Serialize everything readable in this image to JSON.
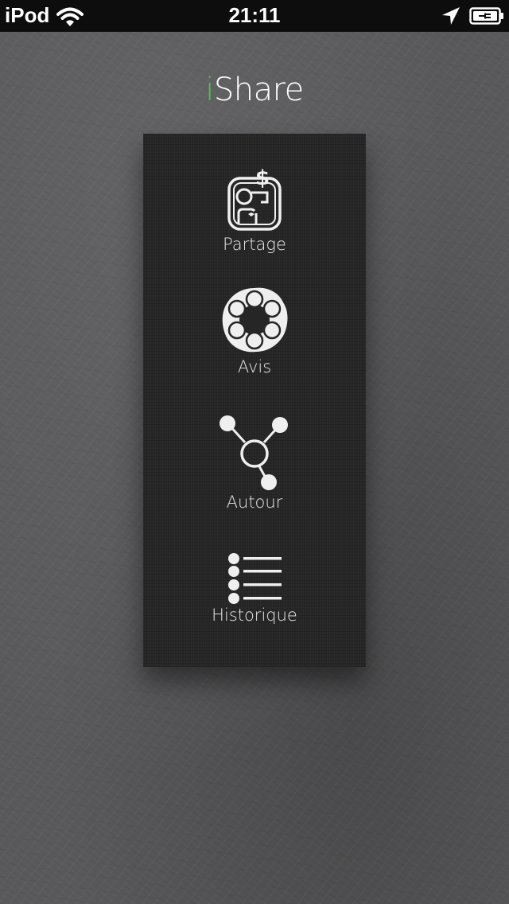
{
  "status_bar": {
    "carrier": "iPod",
    "time": "21:11",
    "wifi_icon": "wifi-icon",
    "location_icon": "location-arrow-icon",
    "battery_icon": "battery-charging-icon"
  },
  "header": {
    "title_accent": "i",
    "title_rest": "Share",
    "accent_color": "#3ecf3e"
  },
  "menu": {
    "items": [
      {
        "label": "Partage",
        "icon": "partage-icon"
      },
      {
        "label": "Avis",
        "icon": "avis-icon"
      },
      {
        "label": "Autour",
        "icon": "autour-icon"
      },
      {
        "label": "Historique",
        "icon": "historique-icon"
      }
    ]
  }
}
